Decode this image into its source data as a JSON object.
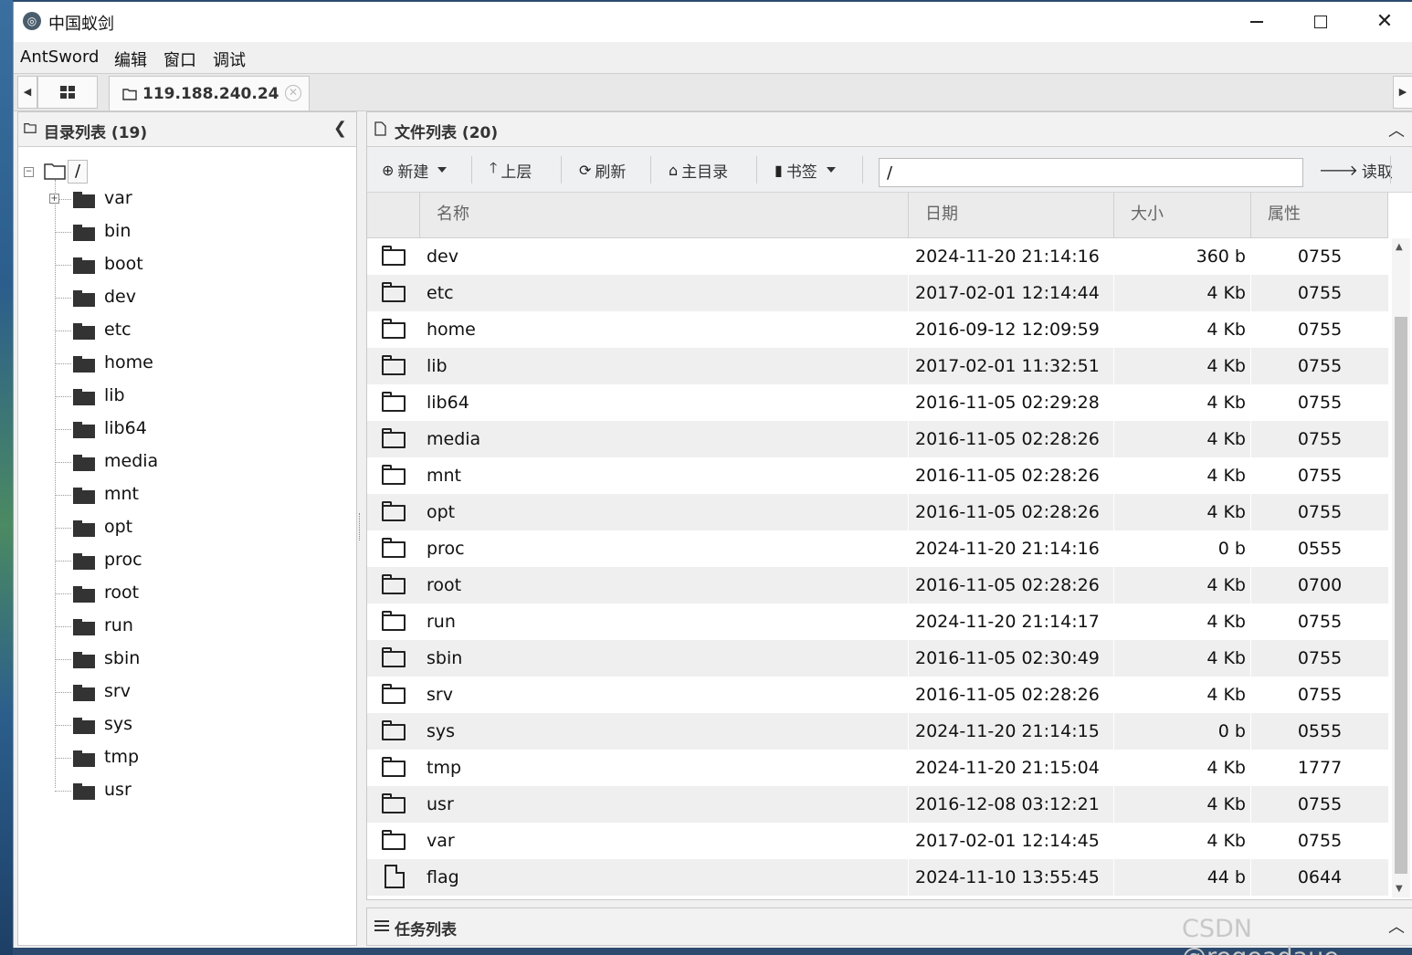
{
  "window": {
    "title": "中国蚁剑",
    "icon": "antsword-logo-icon"
  },
  "menu": [
    "AntSword",
    "编辑",
    "窗口",
    "调试"
  ],
  "tabs": {
    "host_label": "119.188.240.24"
  },
  "left_panel": {
    "title": "目录列表 (19)",
    "root": "/",
    "items": [
      "var",
      "bin",
      "boot",
      "dev",
      "etc",
      "home",
      "lib",
      "lib64",
      "media",
      "mnt",
      "opt",
      "proc",
      "root",
      "run",
      "sbin",
      "srv",
      "sys",
      "tmp",
      "usr"
    ]
  },
  "right_panel": {
    "title": "文件列表 (20)",
    "toolbar": {
      "new": "新建",
      "up": "上层",
      "refresh": "刷新",
      "home": "主目录",
      "bookmark": "书签",
      "read": "读取",
      "path": "/"
    },
    "columns": [
      "名称",
      "日期",
      "大小",
      "属性"
    ],
    "rows": [
      {
        "type": "folder",
        "name": "dev",
        "date": "2024-11-20 21:14:16",
        "size": "360 b",
        "attr": "0755"
      },
      {
        "type": "folder",
        "name": "etc",
        "date": "2017-02-01 12:14:44",
        "size": "4 Kb",
        "attr": "0755"
      },
      {
        "type": "folder",
        "name": "home",
        "date": "2016-09-12 12:09:59",
        "size": "4 Kb",
        "attr": "0755"
      },
      {
        "type": "folder",
        "name": "lib",
        "date": "2017-02-01 11:32:51",
        "size": "4 Kb",
        "attr": "0755"
      },
      {
        "type": "folder",
        "name": "lib64",
        "date": "2016-11-05 02:29:28",
        "size": "4 Kb",
        "attr": "0755"
      },
      {
        "type": "folder",
        "name": "media",
        "date": "2016-11-05 02:28:26",
        "size": "4 Kb",
        "attr": "0755"
      },
      {
        "type": "folder",
        "name": "mnt",
        "date": "2016-11-05 02:28:26",
        "size": "4 Kb",
        "attr": "0755"
      },
      {
        "type": "folder",
        "name": "opt",
        "date": "2016-11-05 02:28:26",
        "size": "4 Kb",
        "attr": "0755"
      },
      {
        "type": "folder",
        "name": "proc",
        "date": "2024-11-20 21:14:16",
        "size": "0 b",
        "attr": "0555"
      },
      {
        "type": "folder",
        "name": "root",
        "date": "2016-11-05 02:28:26",
        "size": "4 Kb",
        "attr": "0700"
      },
      {
        "type": "folder",
        "name": "run",
        "date": "2024-11-20 21:14:17",
        "size": "4 Kb",
        "attr": "0755"
      },
      {
        "type": "folder",
        "name": "sbin",
        "date": "2016-11-05 02:30:49",
        "size": "4 Kb",
        "attr": "0755"
      },
      {
        "type": "folder",
        "name": "srv",
        "date": "2016-11-05 02:28:26",
        "size": "4 Kb",
        "attr": "0755"
      },
      {
        "type": "folder",
        "name": "sys",
        "date": "2024-11-20 21:14:15",
        "size": "0 b",
        "attr": "0555"
      },
      {
        "type": "folder",
        "name": "tmp",
        "date": "2024-11-20 21:15:04",
        "size": "4 Kb",
        "attr": "1777"
      },
      {
        "type": "folder",
        "name": "usr",
        "date": "2016-12-08 03:12:21",
        "size": "4 Kb",
        "attr": "0755"
      },
      {
        "type": "folder",
        "name": "var",
        "date": "2017-02-01 12:14:45",
        "size": "4 Kb",
        "attr": "0755"
      },
      {
        "type": "file",
        "name": "flag",
        "date": "2024-11-10 13:55:45",
        "size": "44 b",
        "attr": "0644"
      }
    ]
  },
  "task_panel": {
    "title": "任务列表"
  },
  "watermark": "CSDN @reqeadaue"
}
